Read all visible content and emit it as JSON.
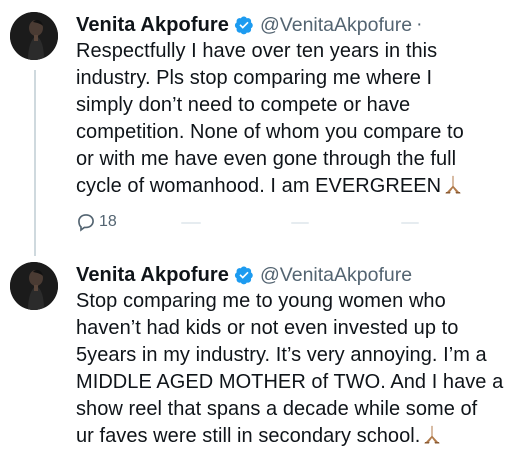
{
  "tweets": [
    {
      "display_name": "Venita Akpofure",
      "handle": "@VenitaAkpofure",
      "separator": "·",
      "text": "Respectfully I have over ten years in this\nindustry. Pls stop comparing me where I\nsimply don’t need to compete or have\ncompetition. None of whom you compare to\nor with me have even gone through the full\ncycle of womanhood. I am EVERGREEN",
      "reply_count": "18"
    },
    {
      "display_name": "Venita Akpofure",
      "handle": "@VenitaAkpofure",
      "text": "Stop comparing me to young women who\nhaven’t had kids or not even invested up to\n5years in my industry. It’s very annoying. I’m a\nMIDDLE AGED MOTHER of TWO. And I have a\nshow reel that spans a decade while some of\nur faves were still in secondary school."
    }
  ],
  "icons": {
    "verified": "verified-badge-icon",
    "reply": "reply-bubble-icon",
    "emoji": "folded-hands-emoji"
  },
  "colors": {
    "verified_blue": "#1d9bf0",
    "secondary_text": "#536471"
  }
}
